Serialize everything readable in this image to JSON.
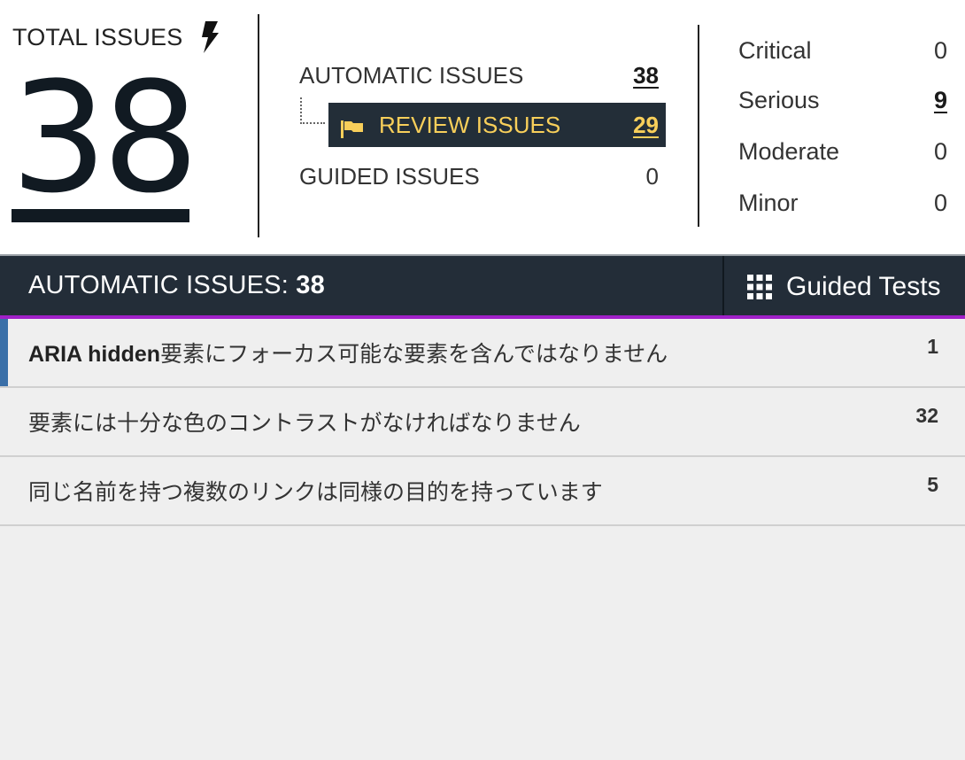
{
  "total": {
    "label": "TOTAL ISSUES",
    "icon": "lightning-bolt-icon",
    "count": "38"
  },
  "breakdown": {
    "automatic": {
      "label": "AUTOMATIC ISSUES",
      "count": "38"
    },
    "review": {
      "label": "REVIEW ISSUES",
      "count": "29",
      "icon": "flag-icon"
    },
    "guided": {
      "label": "GUIDED ISSUES",
      "count": "0"
    }
  },
  "severity": [
    {
      "label": "Critical",
      "count": "0"
    },
    {
      "label": "Serious",
      "count": "9"
    },
    {
      "label": "Moderate",
      "count": "0"
    },
    {
      "label": "Minor",
      "count": "0"
    }
  ],
  "bar": {
    "title_prefix": "AUTOMATIC ISSUES: ",
    "title_count": "38",
    "guided_label": "Guided Tests",
    "guided_icon": "grid-icon"
  },
  "issues": [
    {
      "bold": "ARIA hidden",
      "text": "要素にフォーカス可能な要素を含んではなりません",
      "count": "1"
    },
    {
      "bold": "",
      "text": "要素には十分な色のコントラストがなければなりません",
      "count": "32"
    },
    {
      "bold": "",
      "text": "同じ名前を持つ複数のリンクは同様の目的を持っています",
      "count": "5"
    }
  ],
  "colors": {
    "review_bg": "#232e38",
    "review_text": "#f8cf5a",
    "bar_bg": "#232d38",
    "accent": "#a020c8",
    "selected_marker": "#3a6fa8"
  }
}
